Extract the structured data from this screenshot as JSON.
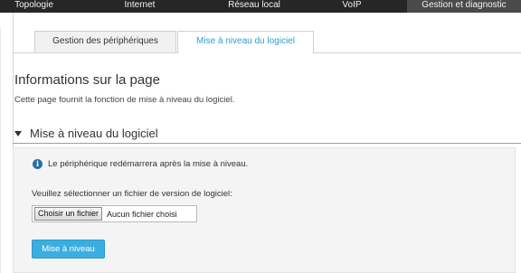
{
  "top_nav": {
    "items": [
      {
        "label": "Topologie",
        "active": false
      },
      {
        "label": "Internet",
        "active": false
      },
      {
        "label": "Réseau local",
        "active": false
      },
      {
        "label": "VoIP",
        "active": false
      },
      {
        "label": "Gestion et diagnostic",
        "active": true
      }
    ]
  },
  "tabs": [
    {
      "label": "Gestion des périphériques",
      "active": false
    },
    {
      "label": "Mise à niveau du logiciel",
      "active": true
    }
  ],
  "page_info": {
    "title": "Informations sur la page",
    "description": "Cette page fournit la fonction de mise à niveau du logiciel."
  },
  "section": {
    "title": "Mise à niveau du logiciel",
    "notice": "Le périphérique redémarrera après la mise à niveau.",
    "notice_icon": "info-icon",
    "select_label": "Veuillez sélectionner un fichier de version de logiciel:",
    "file_button_label": "Choisir un fichier",
    "file_status": "Aucun fichier choisi",
    "upgrade_button_label": "Mise à niveau"
  },
  "colors": {
    "nav_background": "#262626",
    "active_tab_text": "#2a9fd0",
    "primary_button": "#3aaee0",
    "info_icon": "#2b6ea8"
  }
}
